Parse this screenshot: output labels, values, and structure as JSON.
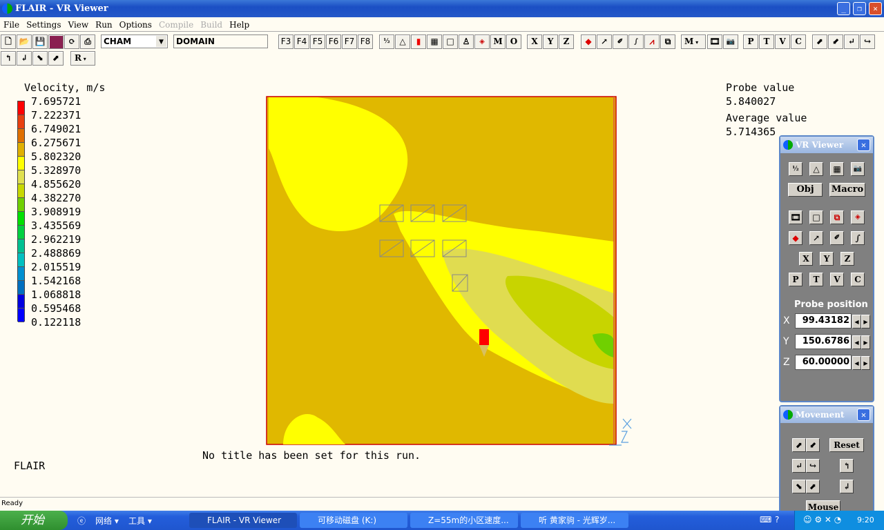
{
  "window": {
    "title": "FLAIR - VR Viewer"
  },
  "menu": [
    "File",
    "Settings",
    "View",
    "Run",
    "Options",
    "Compile",
    "Build",
    "Help"
  ],
  "menu_disabled": [
    "Compile",
    "Build"
  ],
  "toolbar": {
    "combo_value": "CHAM",
    "domain_value": "DOMAIN",
    "fkeys": [
      "F3",
      "F4",
      "F5",
      "F6",
      "F7",
      "F8"
    ],
    "letters1": [
      "M",
      "O"
    ],
    "axes": [
      "X",
      "Y",
      "Z"
    ],
    "m_combo": "M",
    "letters2": [
      "P",
      "T",
      "V",
      "C"
    ],
    "r_combo": "R"
  },
  "legend": {
    "title": "Velocity, m/s",
    "values": [
      "7.695721",
      "7.222371",
      "6.749021",
      "6.275671",
      "5.802320",
      "5.328970",
      "4.855620",
      "4.382270",
      "3.908919",
      "3.435569",
      "2.962219",
      "2.488869",
      "2.015519",
      "1.542168",
      "1.068818",
      "0.595468",
      "0.122118"
    ],
    "colors": [
      "#ff0000",
      "#e84010",
      "#e07000",
      "#e0b000",
      "#ffff00",
      "#e0e050",
      "#c8d800",
      "#70d000",
      "#00e000",
      "#00d040",
      "#00c090",
      "#00c0c0",
      "#0090d0",
      "#0070c0",
      "#0000e0",
      "#0000ff"
    ]
  },
  "probe": {
    "label": "Probe value",
    "value": "5.840027",
    "avg_label": "Average value",
    "avg_value": "5.714365"
  },
  "run_title": "No title has been set for this run.",
  "app_label": "FLAIR",
  "status": "Ready",
  "vr_panel": {
    "title": "VR Viewer",
    "obj": "Obj",
    "macro": "Macro",
    "axes": [
      "X",
      "Y",
      "Z"
    ],
    "letters": [
      "P",
      "T",
      "V",
      "C"
    ],
    "probe_title": "Probe position",
    "x_label": "X",
    "y_label": "Y",
    "z_label": "Z",
    "x": "99.43182",
    "y": "150.6786",
    "z": "60.00000"
  },
  "movement_panel": {
    "title": "Movement",
    "reset": "Reset",
    "mouse": "Mouse"
  },
  "taskbar": {
    "start": "开始",
    "quick": [
      "网络 ▾",
      "工具 ▾"
    ],
    "tasks": [
      "FLAIR - VR Viewer",
      "可移动磁盘 (K:)",
      "Z=55m的小区速度...",
      "听  黄家驹 - 光辉岁..."
    ],
    "clock": "9:20"
  }
}
